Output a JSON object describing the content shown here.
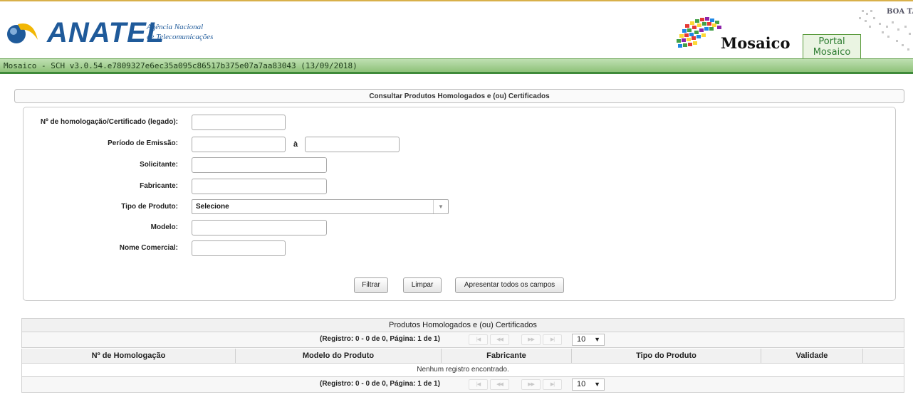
{
  "header": {
    "logo_word": "ANATEL",
    "logo_sub_line1": "Agência Nacional",
    "logo_sub_line2": "de Telecomunicações",
    "brand": "Mosaico",
    "portal_tab_line1": "Portal",
    "portal_tab_line2": "Mosaico",
    "greeting": "BOA TARDE"
  },
  "version_bar": {
    "text": "Mosaico - SCH  v3.0.54.e7809327e6ec35a095c86517b375e07a7aa83043 (13/09/2018)"
  },
  "filter": {
    "title": "Consultar Produtos Homologados e (ou) Certificados",
    "labels": {
      "homologacao": "Nº de homologação/Certificado (legado):",
      "periodo": "Período de Emissão:",
      "periodo_sep": "à",
      "solicitante": "Solicitante:",
      "fabricante": "Fabricante:",
      "tipo": "Tipo de Produto:",
      "modelo": "Modelo:",
      "nome_comercial": "Nome Comercial:"
    },
    "values": {
      "homologacao": "",
      "periodo_inicio": "",
      "periodo_fim": "",
      "solicitante": "",
      "fabricante": "",
      "modelo": "",
      "nome_comercial": ""
    },
    "tipo_selected": "Selecione",
    "buttons": {
      "filtrar": "Filtrar",
      "limpar": "Limpar",
      "todos_campos": "Apresentar todos os campos"
    }
  },
  "results": {
    "title": "Produtos Homologados e (ou) Certificados",
    "pager_text": "(Registro: 0 - 0 de 0, Página: 1 de 1)",
    "page_size": "10",
    "columns": [
      "Nº de Homologação",
      "Modelo do Produto",
      "Fabricante",
      "Tipo do Produto",
      "Validade",
      ""
    ],
    "empty_message": "Nenhum registro encontrado."
  },
  "colors": {
    "brand_blue": "#1f5a9a",
    "bar_green": "#8fc27a",
    "bar_border": "#3f8a3a"
  }
}
